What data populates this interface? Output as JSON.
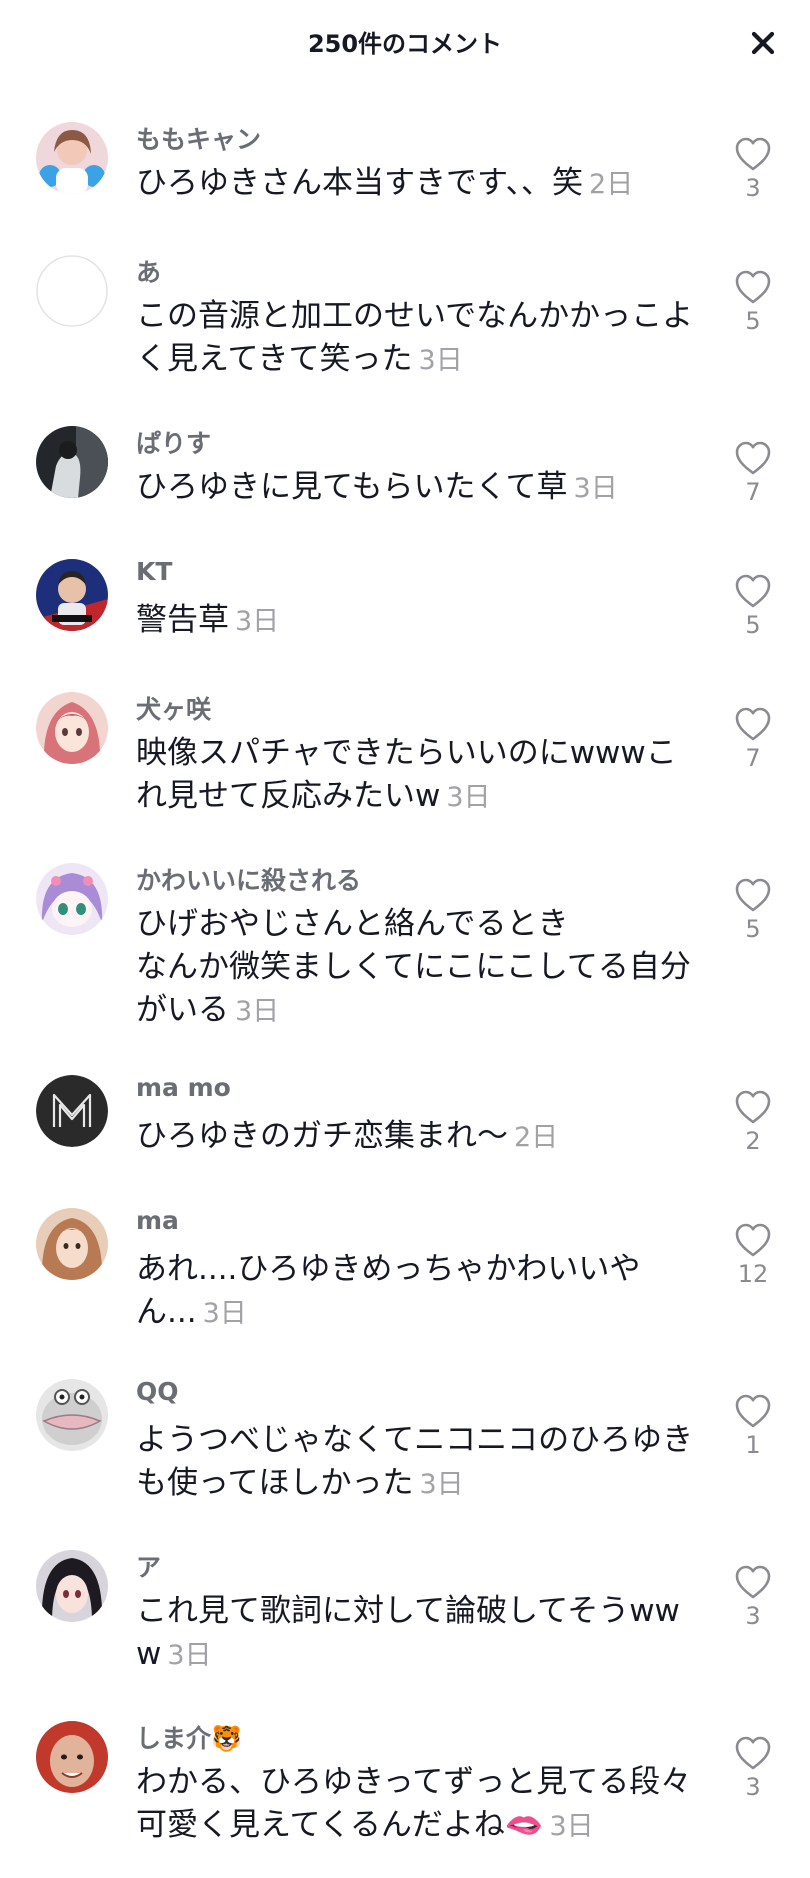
{
  "header": {
    "title": "250件のコメント"
  },
  "icons": {
    "close": "close-icon",
    "like": "heart-outline-icon"
  },
  "colors": {
    "username": "#6b6d75",
    "time": "#a1a2a7",
    "text": "#161823"
  },
  "comments": [
    {
      "username": "ももキャン",
      "text": "ひろゆきさん本当すきです、、笑",
      "time": "2日",
      "likes": "3",
      "avatar_color": "#e9c6cf"
    },
    {
      "username": "あ",
      "text": "この音源と加工のせいでなんかかっこよく見えてきて笑った",
      "time": "3日",
      "likes": "5",
      "avatar_color": "#ffffff"
    },
    {
      "username": "ぱりす",
      "text": "ひろゆきに見てもらいたくて草",
      "time": "3日",
      "likes": "7",
      "avatar_color": "#2b2f33"
    },
    {
      "username": "KT",
      "text": "警告草",
      "time": "3日",
      "likes": "5",
      "avatar_color": "#1f3c8c"
    },
    {
      "username": "犬ヶ咲",
      "text": "映像スパチャできたらいいのにwwwこれ見せて反応みたいw",
      "time": "3日",
      "likes": "7",
      "avatar_color": "#d98a8a"
    },
    {
      "username": "かわいいに殺される",
      "text": "ひげおやじさんと絡んでるとき\nなんか微笑ましくてにこにこしてる自分がいる",
      "time": "3日",
      "likes": "5",
      "avatar_color": "#c9b3e6"
    },
    {
      "username": "ma mo",
      "text": "ひろゆきのガチ恋集まれ〜",
      "time": "2日",
      "likes": "2",
      "avatar_color": "#2a2a2a"
    },
    {
      "username": "ma",
      "text": "あれ....ひろゆきめっちゃかわいいやん...",
      "time": "3日",
      "likes": "12",
      "avatar_color": "#d4a27a"
    },
    {
      "username": "QQ",
      "text": "ようつべじゃなくてニコニコのひろゆきも使ってほしかった",
      "time": "3日",
      "likes": "1",
      "avatar_color": "#cfcfcf"
    },
    {
      "username": "ア",
      "text": "これ見て歌詞に対して論破してそうwww",
      "time": "3日",
      "likes": "3",
      "avatar_color": "#3a2f3b"
    },
    {
      "username": "しま介🐯",
      "text": "わかる、ひろゆきってずっと見てる段々可愛く見えてくるんだよね🫦",
      "time": "3日",
      "likes": "3",
      "avatar_color": "#c0392b"
    }
  ]
}
